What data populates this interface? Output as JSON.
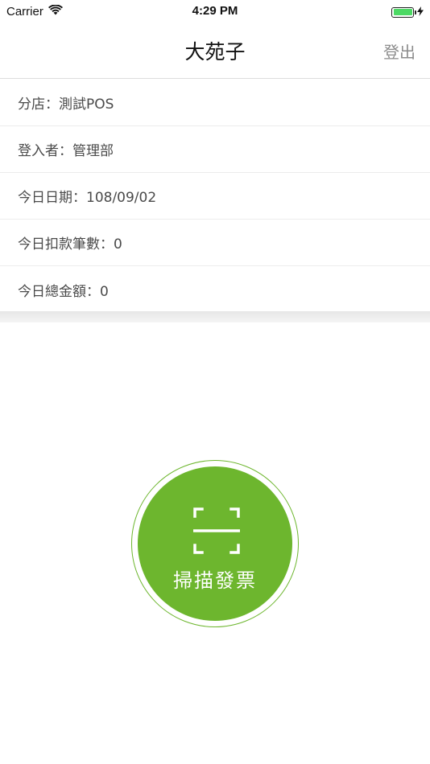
{
  "status_bar": {
    "carrier": "Carrier",
    "time": "4:29 PM",
    "battery_level": 1.0,
    "battery_color": "#4cd964",
    "icons": [
      "wifi-icon",
      "battery-icon",
      "charging-bolt-icon"
    ]
  },
  "nav": {
    "title": "大苑子",
    "logout_label": "登出"
  },
  "info": {
    "branch": "分店：測試POS",
    "login_user": "登入者：管理部",
    "today_date": "今日日期：108/09/02",
    "today_deductions": "今日扣款筆數：0",
    "today_total": "今日總金額：0"
  },
  "scan_button": {
    "label": "掃描發票",
    "icon": "scan-frame-icon",
    "color": "#6db62e"
  }
}
